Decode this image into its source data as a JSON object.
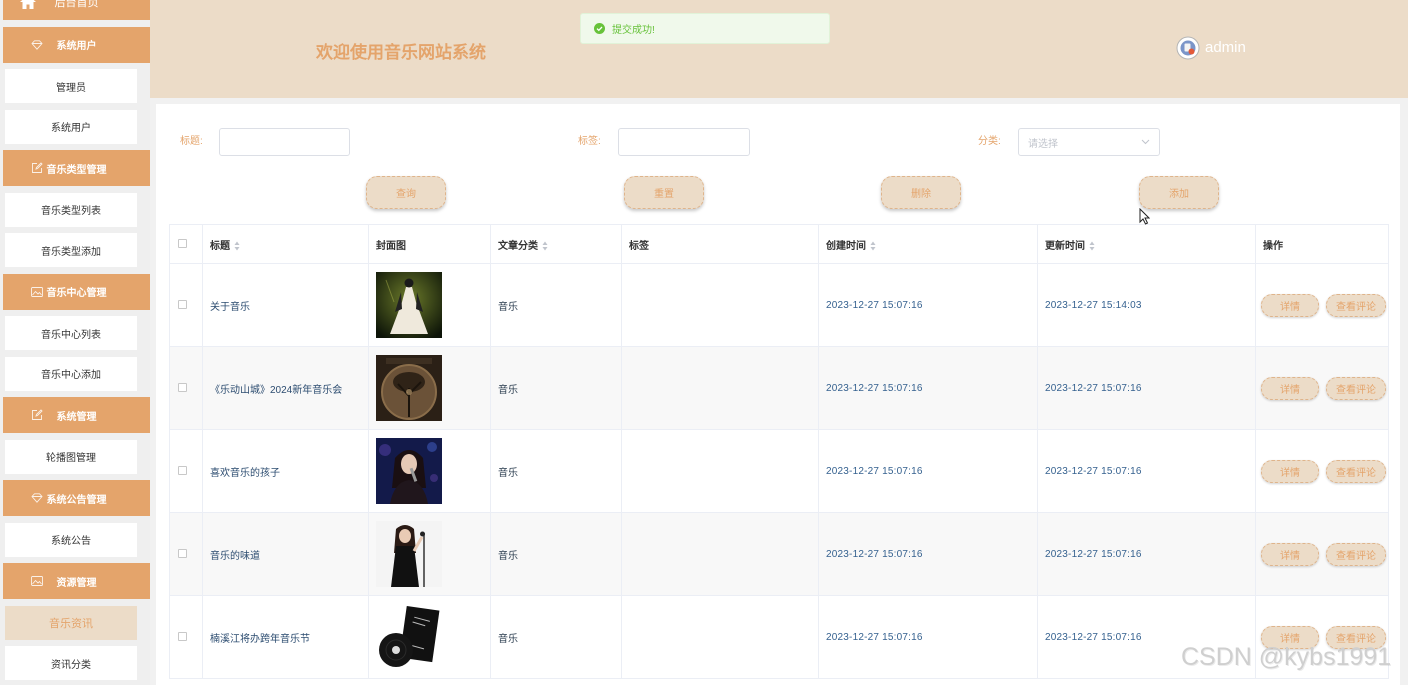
{
  "colors": {
    "accent": "#e4a46b",
    "header_bg": "#ecdcc8",
    "sidebar_bg": "#efefef",
    "success": "#67c23a",
    "date_text": "#35618f"
  },
  "sidebar": {
    "home": {
      "label": "后台首页",
      "icon": "home-icon"
    },
    "groups": [
      {
        "title": "系统用户",
        "icon": "diamond-icon",
        "items": [
          "管理员",
          "系统用户"
        ]
      },
      {
        "title": "音乐类型管理",
        "icon": "edit-icon",
        "items": [
          "音乐类型列表",
          "音乐类型添加"
        ]
      },
      {
        "title": "音乐中心管理",
        "icon": "image-icon",
        "items": [
          "音乐中心列表",
          "音乐中心添加"
        ]
      },
      {
        "title": "系统管理",
        "icon": "edit-icon",
        "items": [
          "轮播图管理"
        ]
      },
      {
        "title": "系统公告管理",
        "icon": "diamond-icon",
        "items": [
          "系统公告"
        ]
      },
      {
        "title": "资源管理",
        "icon": "image-icon",
        "items": [
          "音乐资讯",
          "资讯分类"
        ]
      }
    ],
    "active_item": "音乐资讯"
  },
  "header": {
    "title": "欢迎使用音乐网站系统",
    "username": "admin",
    "avatar_icon": "avatar-icon"
  },
  "toast": {
    "type": "success",
    "icon": "success-check-icon",
    "message": "提交成功!"
  },
  "search": {
    "title_label": "标题:",
    "title_value": "",
    "tag_label": "标签:",
    "tag_value": "",
    "category_label": "分类:",
    "category_placeholder": "请选择"
  },
  "toolbar": {
    "query_label": "查询",
    "reset_label": "重置",
    "delete_label": "删除",
    "add_label": "添加"
  },
  "table": {
    "columns": [
      {
        "label": "标题",
        "sortable": true
      },
      {
        "label": "封面图",
        "sortable": false
      },
      {
        "label": "文章分类",
        "sortable": true
      },
      {
        "label": "标签",
        "sortable": false
      },
      {
        "label": "创建时间",
        "sortable": true
      },
      {
        "label": "更新时间",
        "sortable": true
      },
      {
        "label": "操作",
        "sortable": false
      }
    ],
    "rows": [
      {
        "title": "关于音乐",
        "category": "音乐",
        "created_at": "2023-12-27 15:07:16",
        "updated_at": "2023-12-27 15:14:03"
      },
      {
        "title": "《乐动山城》2024新年音乐会",
        "category": "音乐",
        "created_at": "2023-12-27 15:07:16",
        "updated_at": "2023-12-27 15:07:16"
      },
      {
        "title": "喜欢音乐的孩子",
        "category": "音乐",
        "created_at": "2023-12-27 15:07:16",
        "updated_at": "2023-12-27 15:07:16"
      },
      {
        "title": "音乐的味道",
        "category": "音乐",
        "created_at": "2023-12-27 15:07:16",
        "updated_at": "2023-12-27 15:07:16"
      },
      {
        "title": "楠溪江将办跨年音乐节",
        "category": "音乐",
        "created_at": "2023-12-27 15:07:16",
        "updated_at": "2023-12-27 15:07:16"
      }
    ],
    "row_actions": {
      "detail_label": "详情",
      "comments_label": "查看评论"
    }
  },
  "watermark": "CSDN @kybs1991"
}
